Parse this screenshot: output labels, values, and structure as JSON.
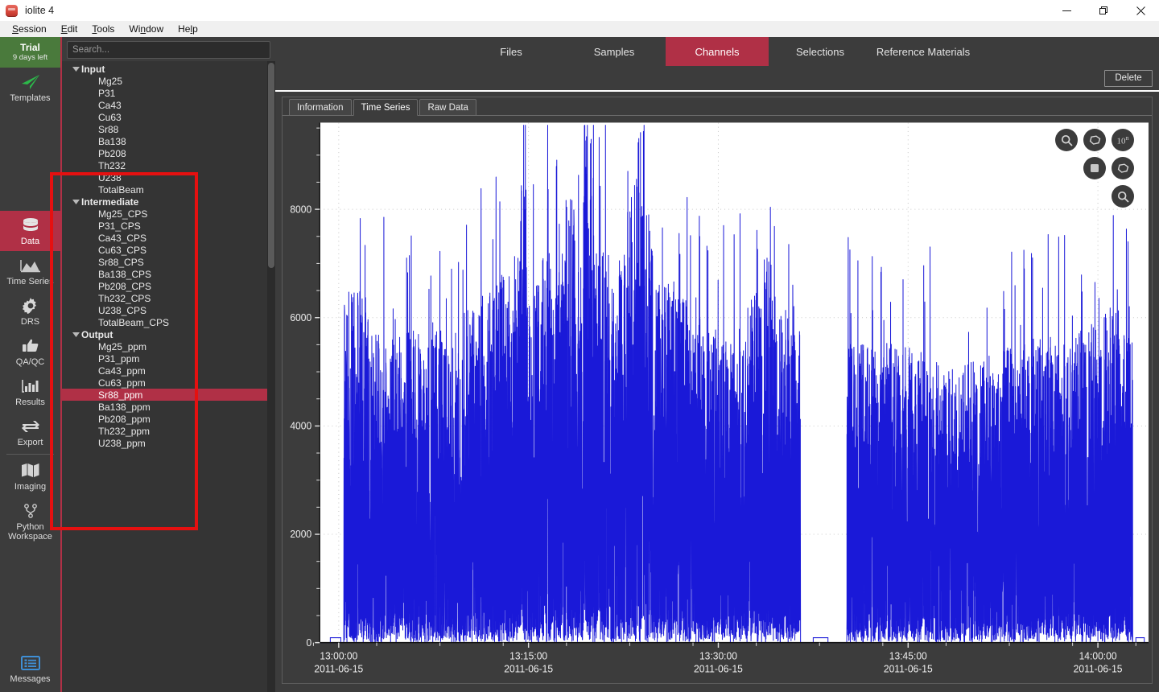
{
  "window": {
    "title": "iolite 4",
    "app_icon": "iolite-logo-icon",
    "controls": {
      "minimize": "minimize-icon",
      "restore": "restore-icon",
      "close": "close-icon"
    }
  },
  "menubar": {
    "items": [
      "Session",
      "Edit",
      "Tools",
      "Window",
      "Help"
    ]
  },
  "trial": {
    "line1": "Trial",
    "line2": "9 days left"
  },
  "rail": {
    "items": [
      {
        "label": "Templates",
        "icon": "paper-plane-icon",
        "active": false
      },
      {
        "label": "Data",
        "icon": "database-icon",
        "active": true
      },
      {
        "label": "Time Series",
        "icon": "mountain-chart-icon",
        "active": false
      },
      {
        "label": "DRS",
        "icon": "gear-icon",
        "active": false
      },
      {
        "label": "QA/QC",
        "icon": "thumbs-up-icon",
        "active": false
      },
      {
        "label": "Results",
        "icon": "bar-chart-icon",
        "active": false
      },
      {
        "label": "Export",
        "icon": "arrows-exchange-icon",
        "active": false
      },
      {
        "label": "Imaging",
        "icon": "map-icon",
        "active": false
      },
      {
        "label": "Python Workspace",
        "icon": "python-branch-icon",
        "active": false
      }
    ],
    "bottom": {
      "label": "Messages",
      "icon": "message-list-icon"
    }
  },
  "search": {
    "placeholder": "Search...",
    "value": ""
  },
  "tree": {
    "groups": [
      {
        "label": "Input",
        "expanded": true,
        "children": [
          "Mg25",
          "P31",
          "Ca43",
          "Cu63",
          "Sr88",
          "Ba138",
          "Pb208",
          "Th232",
          "U238",
          "TotalBeam"
        ]
      },
      {
        "label": "Intermediate",
        "expanded": true,
        "children": [
          "Mg25_CPS",
          "P31_CPS",
          "Ca43_CPS",
          "Cu63_CPS",
          "Sr88_CPS",
          "Ba138_CPS",
          "Pb208_CPS",
          "Th232_CPS",
          "U238_CPS",
          "TotalBeam_CPS"
        ]
      },
      {
        "label": "Output",
        "expanded": true,
        "children": [
          "Mg25_ppm",
          "P31_ppm",
          "Ca43_ppm",
          "Cu63_ppm",
          "Sr88_ppm",
          "Ba138_ppm",
          "Pb208_ppm",
          "Th232_ppm",
          "U238_ppm"
        ]
      }
    ],
    "selected": "Sr88_ppm"
  },
  "top_tabs": {
    "items": [
      "Files",
      "Samples",
      "Channels",
      "Selections",
      "Reference Materials"
    ],
    "active": "Channels"
  },
  "actions": {
    "delete_label": "Delete"
  },
  "sub_tabs": {
    "items": [
      "Information",
      "Time Series",
      "Raw Data"
    ],
    "active": "Time Series"
  },
  "chart_buttons": [
    {
      "name": "zoom-in-icon",
      "label": ""
    },
    {
      "name": "lasso-select-icon",
      "label": ""
    },
    {
      "name": "log-scale-icon",
      "label": "10n"
    },
    {
      "name": "rectangle-select-icon",
      "label": ""
    },
    {
      "name": "freeform-select-icon",
      "label": ""
    },
    {
      "name": "zoom-out-icon",
      "label": ""
    }
  ],
  "colors": {
    "accent": "#b03046",
    "trial_green": "#4a7a3c",
    "series": "#1a19d8",
    "annotation": "#e51010",
    "panel_bg": "#3c3c3c",
    "plot_bg": "#ffffff"
  },
  "chart_data": {
    "type": "line",
    "title": "",
    "xlabel": "",
    "ylabel": "",
    "series_name": "Sr88_ppm",
    "series_color": "#1a19d8",
    "grid": true,
    "legend": "none",
    "ylim": [
      0,
      9600
    ],
    "yticks": [
      0,
      2000,
      4000,
      6000,
      8000
    ],
    "ytick_labels": [
      "0",
      "2000",
      "4000",
      "6000",
      "8000"
    ],
    "y_minor_step": 500,
    "xlim": [
      "12:58:30",
      "14:04:00"
    ],
    "xticks": [
      "13:00:00",
      "13:15:00",
      "13:30:00",
      "13:45:00",
      "14:00:00"
    ],
    "xtick_dates": [
      "2011-06-15",
      "2011-06-15",
      "2011-06-15",
      "2011-06-15",
      "2011-06-15"
    ],
    "description": "Dense spiky LA-ICP-MS ablation trace: repeated sharp spikes rising from a near-zero baseline, one quiet gap around 13:36-13:40, signal terminating just before 14:03.",
    "peaks": [
      {
        "t": "13:01:00",
        "v": 6150
      },
      {
        "t": "13:01:30",
        "v": 5450
      },
      {
        "t": "13:02:00",
        "v": 5420
      },
      {
        "t": "13:02:30",
        "v": 5270
      },
      {
        "t": "13:03:00",
        "v": 5640
      },
      {
        "t": "13:03:30",
        "v": 5360
      },
      {
        "t": "13:04:20",
        "v": 5500
      },
      {
        "t": "13:04:50",
        "v": 5620
      },
      {
        "t": "13:05:30",
        "v": 5260
      },
      {
        "t": "13:06:10",
        "v": 5580
      },
      {
        "t": "13:06:50",
        "v": 5430
      },
      {
        "t": "13:07:40",
        "v": 5150
      },
      {
        "t": "13:08:30",
        "v": 4760
      },
      {
        "t": "13:09:40",
        "v": 5820
      },
      {
        "t": "13:10:20",
        "v": 6080
      },
      {
        "t": "13:11:00",
        "v": 6140
      },
      {
        "t": "13:12:00",
        "v": 6600
      },
      {
        "t": "13:12:40",
        "v": 5940
      },
      {
        "t": "13:13:20",
        "v": 8080
      },
      {
        "t": "13:13:50",
        "v": 6060
      },
      {
        "t": "13:14:30",
        "v": 6380
      },
      {
        "t": "13:15:10",
        "v": 6930
      },
      {
        "t": "13:15:50",
        "v": 6530
      },
      {
        "t": "13:16:30",
        "v": 6870
      },
      {
        "t": "13:17:10",
        "v": 7720
      },
      {
        "t": "13:17:50",
        "v": 6580
      },
      {
        "t": "13:18:40",
        "v": 9380
      },
      {
        "t": "13:19:20",
        "v": 6700
      },
      {
        "t": "13:20:00",
        "v": 7120
      },
      {
        "t": "13:20:40",
        "v": 6160
      },
      {
        "t": "13:21:20",
        "v": 6820
      },
      {
        "t": "13:22:00",
        "v": 8320
      },
      {
        "t": "13:22:40",
        "v": 9020
      },
      {
        "t": "13:23:20",
        "v": 7470
      },
      {
        "t": "13:24:00",
        "v": 6430
      },
      {
        "t": "13:24:40",
        "v": 6260
      },
      {
        "t": "13:25:20",
        "v": 6330
      },
      {
        "t": "13:26:00",
        "v": 6000
      },
      {
        "t": "13:26:40",
        "v": 5870
      },
      {
        "t": "13:27:20",
        "v": 5640
      },
      {
        "t": "13:28:00",
        "v": 5430
      },
      {
        "t": "13:29:00",
        "v": 5500
      },
      {
        "t": "13:30:00",
        "v": 5300
      },
      {
        "t": "13:31:00",
        "v": 5550
      },
      {
        "t": "13:32:00",
        "v": 6100
      },
      {
        "t": "13:33:00",
        "v": 6720
      },
      {
        "t": "13:34:00",
        "v": 5860
      },
      {
        "t": "13:35:00",
        "v": 5500
      },
      {
        "t": "13:36:00",
        "v": 5470
      },
      {
        "t": "13:40:40",
        "v": 5320
      },
      {
        "t": "13:41:30",
        "v": 5080
      },
      {
        "t": "13:42:20",
        "v": 5290
      },
      {
        "t": "13:43:10",
        "v": 5110
      },
      {
        "t": "13:44:00",
        "v": 5180
      },
      {
        "t": "13:45:00",
        "v": 5000
      },
      {
        "t": "13:46:00",
        "v": 4880
      },
      {
        "t": "13:47:00",
        "v": 4770
      },
      {
        "t": "13:48:00",
        "v": 4820
      },
      {
        "t": "13:49:00",
        "v": 4900
      },
      {
        "t": "13:50:00",
        "v": 5050
      },
      {
        "t": "13:51:00",
        "v": 4700
      },
      {
        "t": "13:52:00",
        "v": 5150
      },
      {
        "t": "13:53:00",
        "v": 5190
      },
      {
        "t": "13:54:00",
        "v": 5330
      },
      {
        "t": "13:55:00",
        "v": 5380
      },
      {
        "t": "13:56:00",
        "v": 5270
      },
      {
        "t": "13:57:00",
        "v": 5420
      },
      {
        "t": "13:58:00",
        "v": 5440
      },
      {
        "t": "13:59:00",
        "v": 5560
      },
      {
        "t": "14:00:00",
        "v": 5900
      },
      {
        "t": "14:01:00",
        "v": 5430
      },
      {
        "t": "14:02:00",
        "v": 5400
      }
    ]
  }
}
